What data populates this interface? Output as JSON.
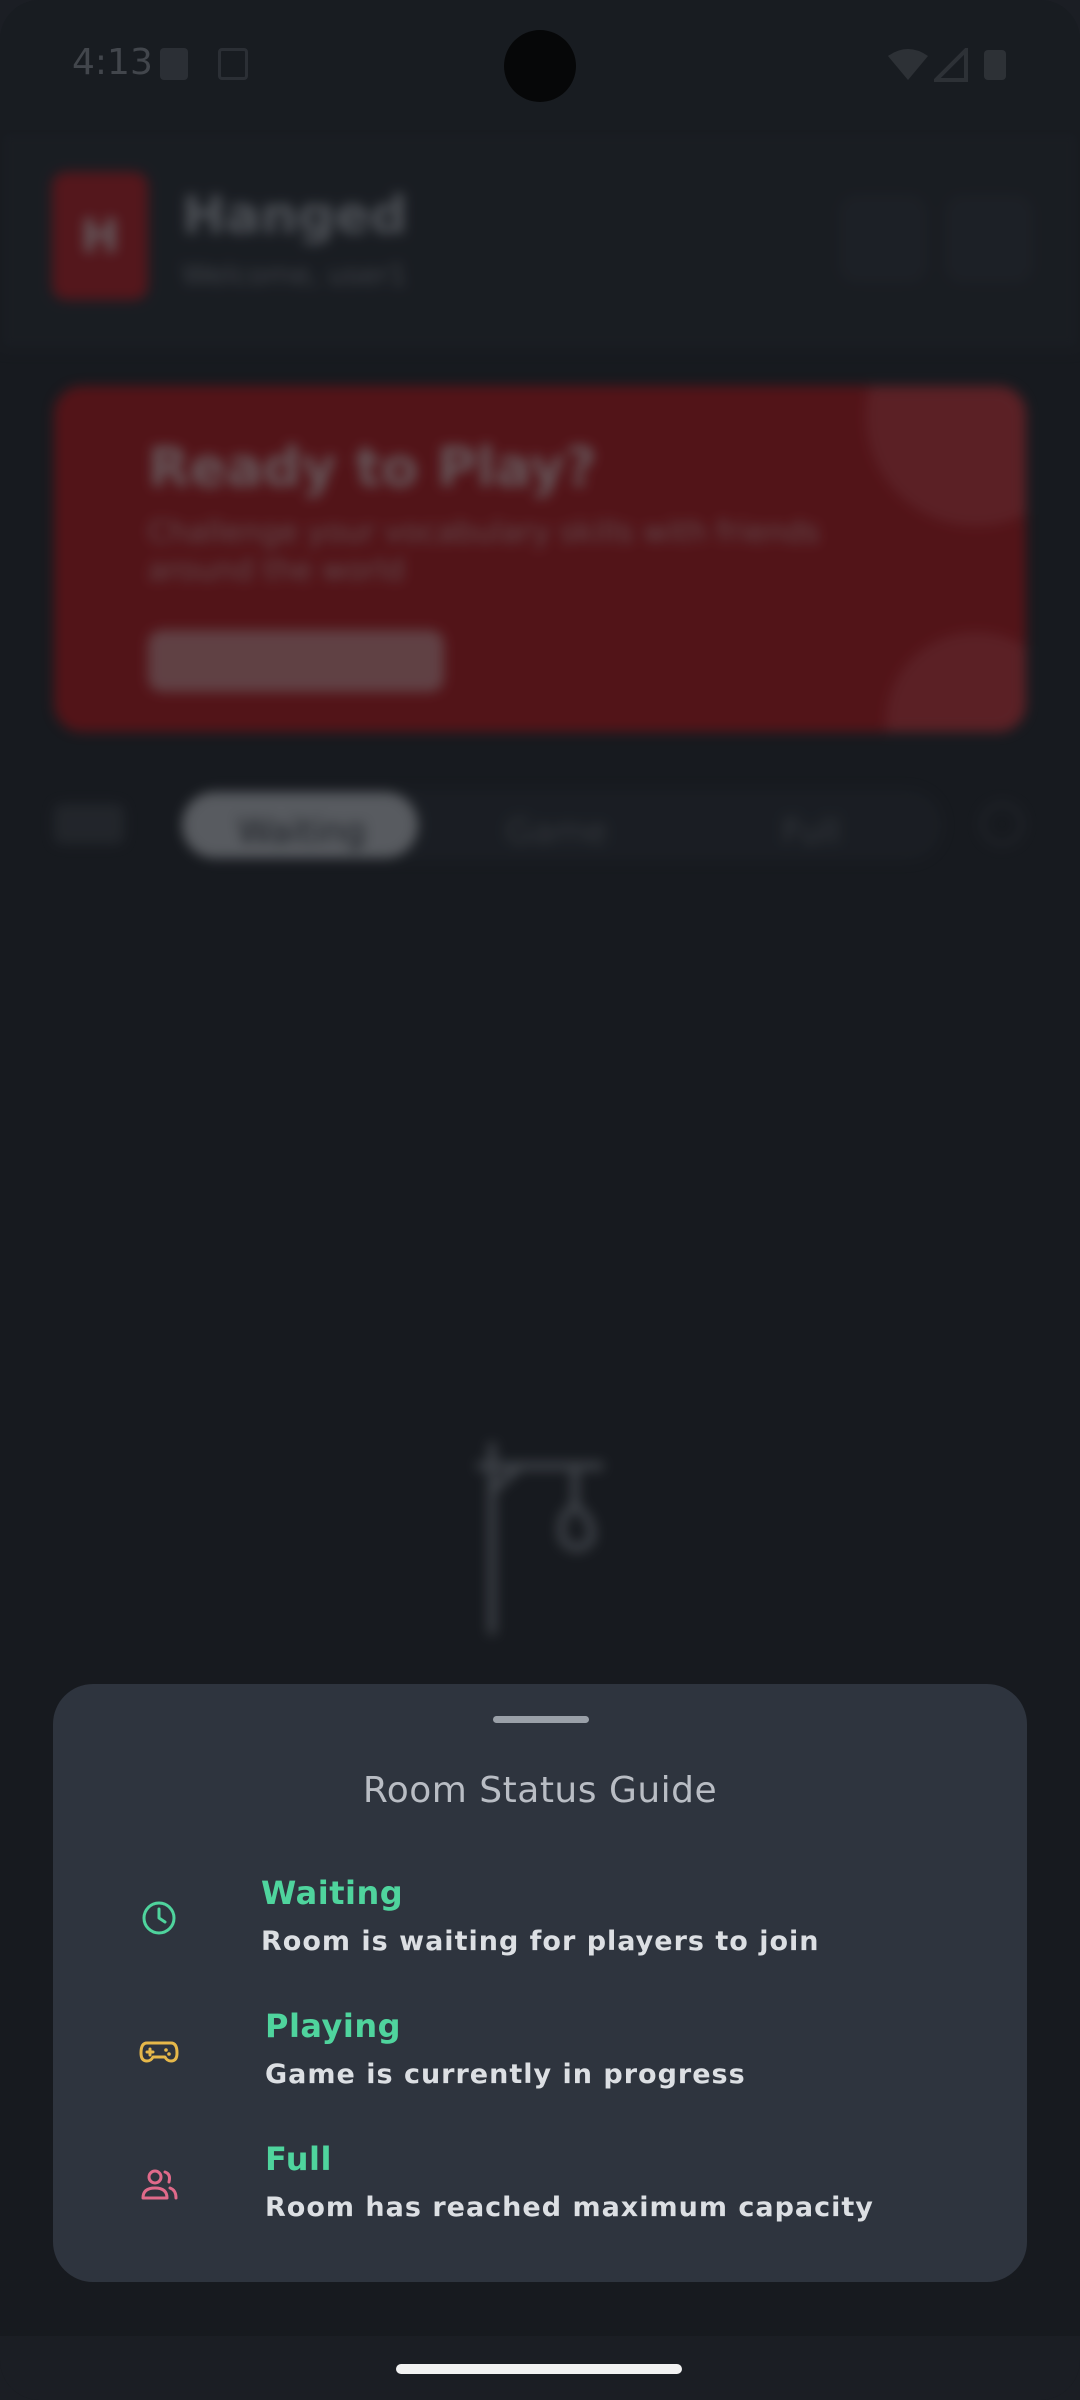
{
  "status_bar": {
    "time": "4:13",
    "icons": [
      "sd-card-icon",
      "font-icon",
      "wifi-icon",
      "signal-icon",
      "battery-icon"
    ]
  },
  "background_app": {
    "logo_letter": "H",
    "title": "Hanged",
    "subtitle": "Welcome, user1",
    "banner": {
      "title": "Ready to Play?",
      "text": "Challenge your vocabulary skills with friends around the world",
      "button_label": ""
    },
    "filter_tabs": [
      "Waiting",
      "Game",
      "Full"
    ],
    "active_tab": "Waiting"
  },
  "sheet": {
    "title": "Room Status Guide",
    "items": [
      {
        "icon": "clock-icon",
        "title": "Waiting",
        "description": "Room is waiting for players to join",
        "icon_color": "#4fd49d"
      },
      {
        "icon": "gamepad-icon",
        "title": "Playing",
        "description": "Game is currently in progress",
        "icon_color": "#e6b84a"
      },
      {
        "icon": "users-icon",
        "title": "Full",
        "description": "Room has reached maximum capacity",
        "icon_color": "#e06a8a"
      }
    ]
  },
  "colors": {
    "accent_red": "#c20d12",
    "status_title_green": "#4fd49d",
    "sheet_background": "#2e343e"
  }
}
